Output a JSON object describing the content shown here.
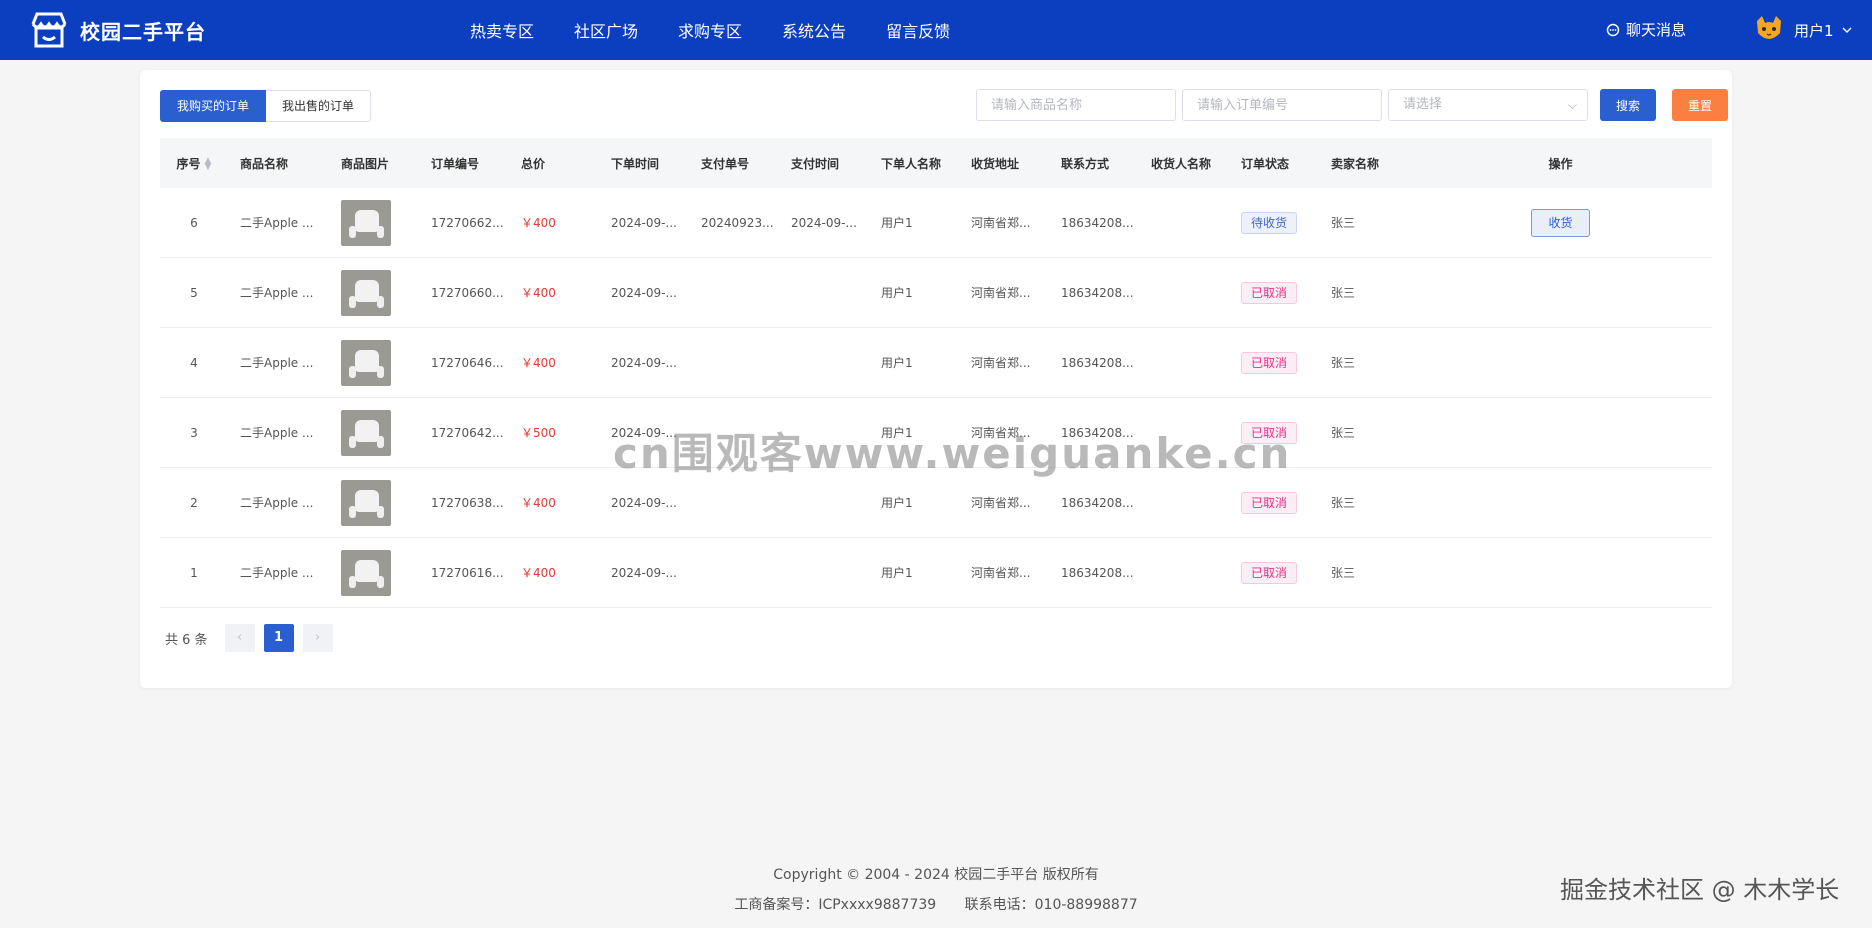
{
  "header": {
    "brand": "校园二手平台",
    "nav": [
      "热卖专区",
      "社区广场",
      "求购专区",
      "系统公告",
      "留言反馈"
    ],
    "chat_label": "聊天消息",
    "user_label": "用户1"
  },
  "tabs": {
    "bought": "我购买的订单",
    "sold": "我出售的订单"
  },
  "filters": {
    "product_placeholder": "请输入商品名称",
    "order_placeholder": "请输入订单编号",
    "select_placeholder": "请选择",
    "search_label": "搜索",
    "reset_label": "重置"
  },
  "table": {
    "columns": [
      "序号",
      "商品名称",
      "商品图片",
      "订单编号",
      "总价",
      "下单时间",
      "支付单号",
      "支付时间",
      "下单人名称",
      "收货地址",
      "联系方式",
      "收货人名称",
      "订单状态",
      "卖家名称",
      "操作"
    ],
    "rows": [
      {
        "idx": "6",
        "name": "二手Apple ...",
        "order_no": "17270662...",
        "price": "￥400",
        "time": "2024-09-...",
        "pay_no": "20240923...",
        "pay_time": "2024-09-...",
        "buyer": "用户1",
        "addr": "河南省郑...",
        "phone": "18634208...",
        "receiver": "",
        "status": "待收货",
        "seller": "张三",
        "action": "收货"
      },
      {
        "idx": "5",
        "name": "二手Apple ...",
        "order_no": "17270660...",
        "price": "￥400",
        "time": "2024-09-...",
        "pay_no": "",
        "pay_time": "",
        "buyer": "用户1",
        "addr": "河南省郑...",
        "phone": "18634208...",
        "receiver": "",
        "status": "已取消",
        "seller": "张三",
        "action": ""
      },
      {
        "idx": "4",
        "name": "二手Apple ...",
        "order_no": "17270646...",
        "price": "￥400",
        "time": "2024-09-...",
        "pay_no": "",
        "pay_time": "",
        "buyer": "用户1",
        "addr": "河南省郑...",
        "phone": "18634208...",
        "receiver": "",
        "status": "已取消",
        "seller": "张三",
        "action": ""
      },
      {
        "idx": "3",
        "name": "二手Apple ...",
        "order_no": "17270642...",
        "price": "￥500",
        "time": "2024-09-...",
        "pay_no": "",
        "pay_time": "",
        "buyer": "用户1",
        "addr": "河南省郑...",
        "phone": "18634208...",
        "receiver": "",
        "status": "已取消",
        "seller": "张三",
        "action": ""
      },
      {
        "idx": "2",
        "name": "二手Apple ...",
        "order_no": "17270638...",
        "price": "￥400",
        "time": "2024-09-...",
        "pay_no": "",
        "pay_time": "",
        "buyer": "用户1",
        "addr": "河南省郑...",
        "phone": "18634208...",
        "receiver": "",
        "status": "已取消",
        "seller": "张三",
        "action": ""
      },
      {
        "idx": "1",
        "name": "二手Apple ...",
        "order_no": "17270616...",
        "price": "￥400",
        "time": "2024-09-...",
        "pay_no": "",
        "pay_time": "",
        "buyer": "用户1",
        "addr": "河南省郑...",
        "phone": "18634208...",
        "receiver": "",
        "status": "已取消",
        "seller": "张三",
        "action": ""
      }
    ]
  },
  "pagination": {
    "total_label": "共 6 条",
    "current_page": "1",
    "prev": "‹",
    "next": "›"
  },
  "watermark": "cn围观客www.weiguanke.cn",
  "footer": {
    "copyright": "Copyright © 2004 - 2024 校园二手平台 版权所有",
    "icp": "工商备案号：ICPxxxx9887739",
    "phone": "联系电话：010-88998877"
  },
  "juejin_watermark": "掘金技术社区 @ 木木学长",
  "colors": {
    "header_bg": "#0b3fbf",
    "primary": "#2a5fcf",
    "reset": "#fb7f41",
    "price": "#e53935",
    "cancel_tag": "#e0338a"
  }
}
